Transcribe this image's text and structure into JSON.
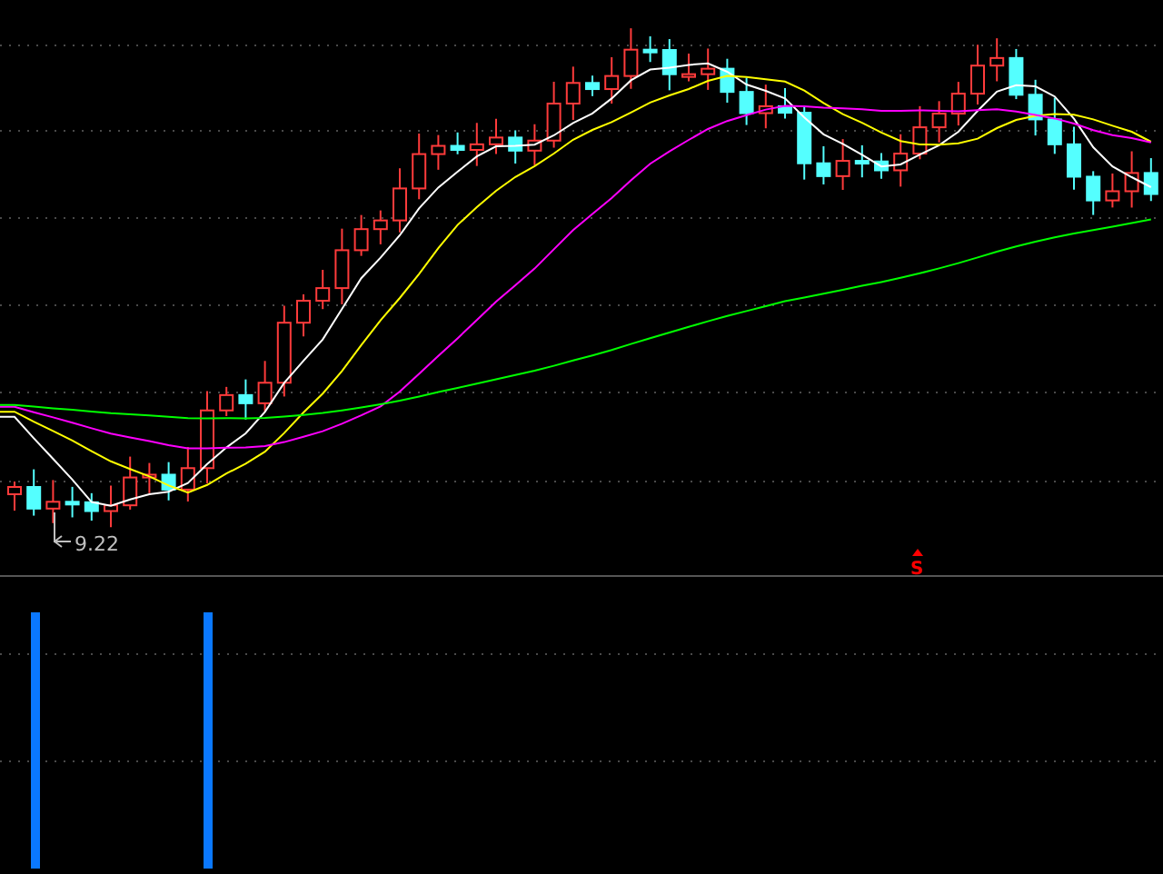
{
  "price_panel": {
    "low_label": "9.22",
    "signal": {
      "label": "S"
    }
  },
  "indicator_panel": {
    "bars": [
      {
        "kind": "signal-bar"
      },
      {
        "kind": "signal-bar"
      }
    ]
  }
}
